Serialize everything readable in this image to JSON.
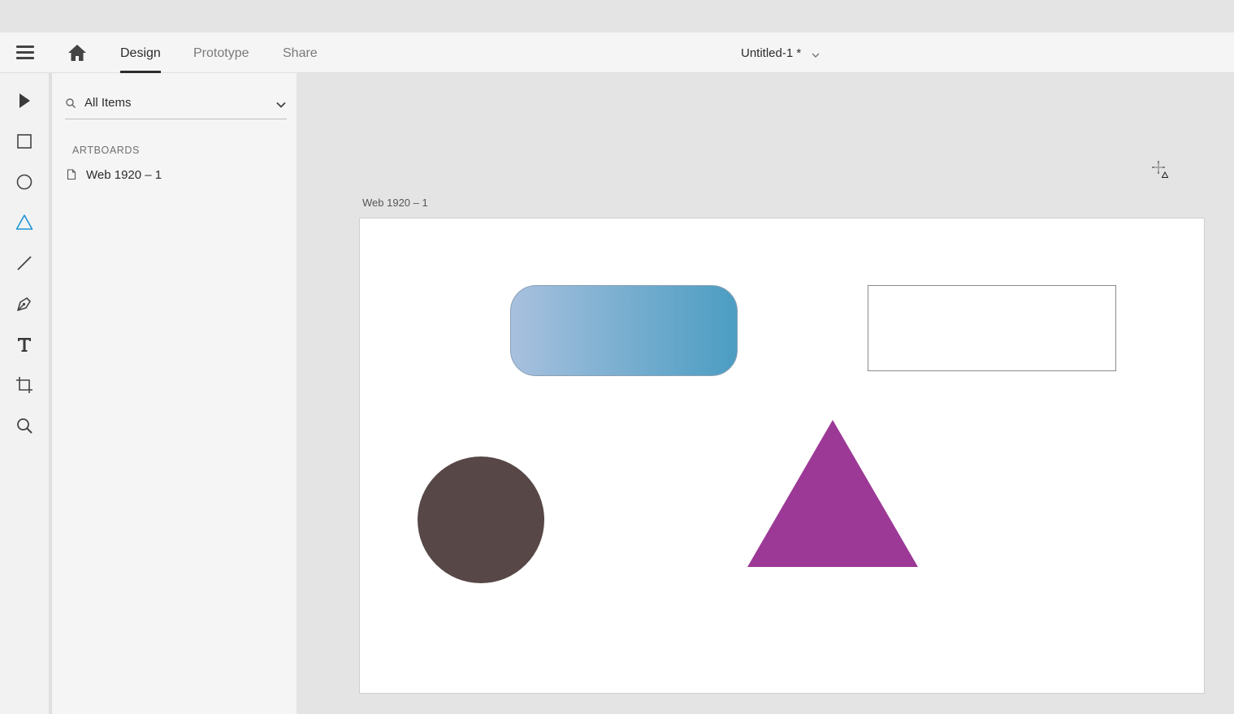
{
  "header": {
    "menu_icon": "hamburger-menu-icon",
    "home_icon": "home-icon",
    "tabs": [
      {
        "label": "Design",
        "active": true
      },
      {
        "label": "Prototype",
        "active": false
      },
      {
        "label": "Share",
        "active": false
      }
    ],
    "document_title": "Untitled-1 *",
    "document_menu_icon": "chevron-down-icon"
  },
  "toolbar": {
    "tools": [
      {
        "name": "select-tool",
        "icon": "arrow-pointer-icon",
        "active": false
      },
      {
        "name": "rectangle-tool",
        "icon": "rectangle-icon",
        "active": false
      },
      {
        "name": "ellipse-tool",
        "icon": "ellipse-icon",
        "active": false
      },
      {
        "name": "polygon-tool",
        "icon": "triangle-icon",
        "active": true
      },
      {
        "name": "line-tool",
        "icon": "line-icon",
        "active": false
      },
      {
        "name": "pen-tool",
        "icon": "pen-icon",
        "active": false
      },
      {
        "name": "text-tool",
        "icon": "text-icon",
        "active": false
      },
      {
        "name": "artboard-tool",
        "icon": "artboard-icon",
        "active": false
      },
      {
        "name": "zoom-tool",
        "icon": "magnifier-icon",
        "active": false
      }
    ]
  },
  "layers": {
    "search_icon": "search-icon",
    "filter_value": "All Items",
    "filter_chevron": "chevron-down-icon",
    "section_title": "ARTBOARDS",
    "items": [
      {
        "label": "Web 1920 – 1",
        "icon": "artboard-page-icon"
      }
    ]
  },
  "canvas": {
    "artboard_name": "Web 1920 – 1",
    "cursor_icon": "polygon-crosshair-cursor-icon",
    "shapes": [
      {
        "type": "rounded-rectangle",
        "fill": "gradient",
        "gradient_from": "#a8c0de",
        "gradient_to": "#4b9dc2"
      },
      {
        "type": "rectangle",
        "fill": "#ffffff",
        "stroke": "#8a8a8a"
      },
      {
        "type": "ellipse",
        "fill": "#574746"
      },
      {
        "type": "triangle",
        "fill": "#9c3996"
      }
    ]
  },
  "colors": {
    "accent": "#1c95d6",
    "icon": "#444444",
    "panel_bg": "#f5f5f5",
    "canvas_bg": "#e4e4e4"
  }
}
